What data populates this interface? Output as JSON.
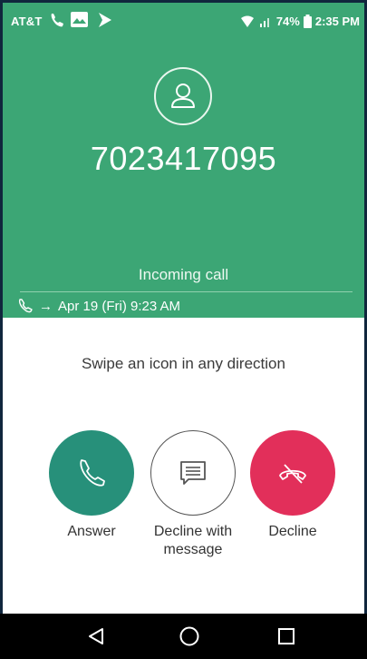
{
  "status_bar": {
    "carrier": "AT&T",
    "battery": "74%",
    "time": "2:35 PM"
  },
  "caller": {
    "number": "7023417095"
  },
  "call_state": "Incoming call",
  "call_log": {
    "arrow": "→",
    "entry": "Apr 19 (Fri) 9:23 AM"
  },
  "hint": "Swipe an icon in any direction",
  "actions": {
    "answer": "Answer",
    "decline_with_message": "Decline with message",
    "decline": "Decline"
  },
  "colors": {
    "header_bg": "#3ca675",
    "answer": "#27907a",
    "decline": "#e22f5a"
  },
  "icons": {
    "avatar": "person-icon",
    "answer": "phone-icon",
    "message": "message-icon",
    "decline": "phone-hangup-icon",
    "nav_back": "back-triangle-icon",
    "nav_home": "home-circle-icon",
    "nav_recents": "recents-square-icon"
  }
}
